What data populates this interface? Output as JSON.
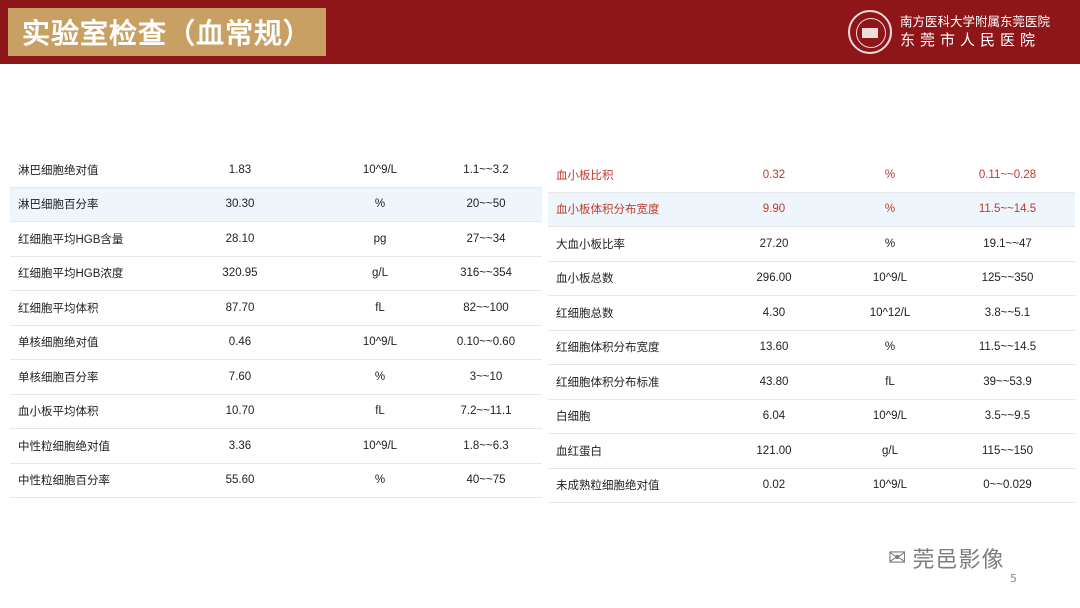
{
  "header": {
    "title": "实验室检查（血常规）",
    "hospital_line1": "南方医科大学附属东莞医院",
    "hospital_line2": "东莞市人民医院"
  },
  "left_table": [
    {
      "name": "淋巴细胞绝对值",
      "value": "1.83",
      "unit": "10^9/L",
      "range": "1.1~~3.2"
    },
    {
      "name": "淋巴细胞百分率",
      "value": "30.30",
      "unit": "%",
      "range": "20~~50"
    },
    {
      "name": "红细胞平均HGB含量",
      "value": "28.10",
      "unit": "pg",
      "range": "27~~34"
    },
    {
      "name": "红细胞平均HGB浓度",
      "value": "320.95",
      "unit": "g/L",
      "range": "316~~354"
    },
    {
      "name": "红细胞平均体积",
      "value": "87.70",
      "unit": "fL",
      "range": "82~~100"
    },
    {
      "name": "单核细胞绝对值",
      "value": "0.46",
      "unit": "10^9/L",
      "range": "0.10~~0.60"
    },
    {
      "name": "单核细胞百分率",
      "value": "7.60",
      "unit": "%",
      "range": "3~~10"
    },
    {
      "name": "血小板平均体积",
      "value": "10.70",
      "unit": "fL",
      "range": "7.2~~11.1"
    },
    {
      "name": "中性粒细胞绝对值",
      "value": "3.36",
      "unit": "10^9/L",
      "range": "1.8~~6.3"
    },
    {
      "name": "中性粒细胞百分率",
      "value": "55.60",
      "unit": "%",
      "range": "40~~75"
    }
  ],
  "right_table": [
    {
      "name": "血小板比积",
      "value": "0.32",
      "unit": "%",
      "range": "0.11~~0.28"
    },
    {
      "name": "血小板体积分布宽度",
      "value": "9.90",
      "unit": "%",
      "range": "11.5~~14.5"
    },
    {
      "name": "大血小板比率",
      "value": "27.20",
      "unit": "%",
      "range": "19.1~~47"
    },
    {
      "name": "血小板总数",
      "value": "296.00",
      "unit": "10^9/L",
      "range": "125~~350"
    },
    {
      "name": "红细胞总数",
      "value": "4.30",
      "unit": "10^12/L",
      "range": "3.8~~5.1"
    },
    {
      "name": "红细胞体积分布宽度",
      "value": "13.60",
      "unit": "%",
      "range": "11.5~~14.5"
    },
    {
      "name": "红细胞体积分布标准",
      "value": "43.80",
      "unit": "fL",
      "range": "39~~53.9"
    },
    {
      "name": "白细胞",
      "value": "6.04",
      "unit": "10^9/L",
      "range": "3.5~~9.5"
    },
    {
      "name": "血红蛋白",
      "value": "121.00",
      "unit": "g/L",
      "range": "115~~150"
    },
    {
      "name": "未成熟粒细胞绝对值",
      "value": "0.02",
      "unit": "10^9/L",
      "range": "0~~0.029"
    }
  ],
  "watermark": "莞邑影像",
  "page_number": "5",
  "colors": {
    "header_bg": "#8e1518",
    "title_bg": "#c9a064",
    "abnormal_text": "#c0392b",
    "highlight_row": "#eef5fb"
  }
}
